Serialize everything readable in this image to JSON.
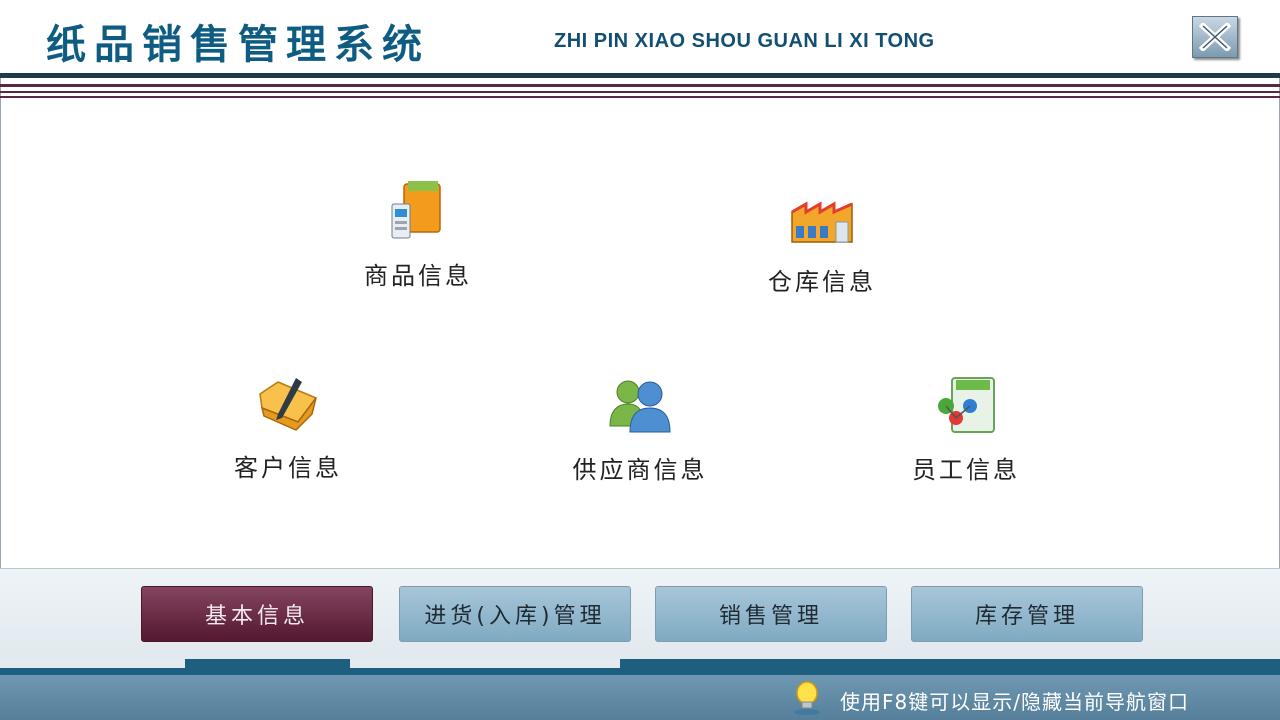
{
  "header": {
    "title_cn": "纸品销售管理系统",
    "title_en": "ZHI PIN XIAO SHOU GUAN LI XI TONG",
    "close_icon": "close-icon"
  },
  "main": {
    "tiles": [
      {
        "label": "商品信息",
        "icon": "product-folder-icon"
      },
      {
        "label": "仓库信息",
        "icon": "warehouse-factory-icon"
      },
      {
        "label": "客户信息",
        "icon": "customer-folder-icon"
      },
      {
        "label": "供应商信息",
        "icon": "supplier-users-icon"
      },
      {
        "label": "员工信息",
        "icon": "employee-book-icon"
      }
    ]
  },
  "nav": {
    "buttons": [
      {
        "label": "基本信息",
        "active": true
      },
      {
        "label": "进货(入库)管理",
        "active": false
      },
      {
        "label": "销售管理",
        "active": false
      },
      {
        "label": "库存管理",
        "active": false
      }
    ]
  },
  "status": {
    "hint": "使用F8键可以显示/隐藏当前导航窗口",
    "icon": "lightbulb-icon"
  },
  "colors": {
    "title": "#0f5c82",
    "active_nav": "#6b2a47",
    "nav": "#8fb6cd",
    "statusbar": "#5f89a4"
  }
}
